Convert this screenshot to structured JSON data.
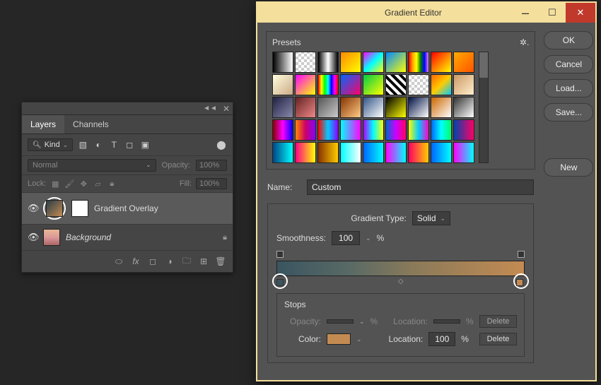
{
  "layers_panel": {
    "tabs": [
      "Layers",
      "Channels"
    ],
    "kind_label": "Kind",
    "blend_mode": "Normal",
    "opacity_label": "Opacity:",
    "opacity_value": "100%",
    "lock_label": "Lock:",
    "fill_label": "Fill:",
    "fill_value": "100%",
    "layers": [
      {
        "name": "Gradient Overlay",
        "italic": false
      },
      {
        "name": "Background",
        "italic": true
      }
    ]
  },
  "gradient_editor": {
    "title": "Gradient Editor",
    "presets_label": "Presets",
    "buttons": {
      "ok": "OK",
      "cancel": "Cancel",
      "load": "Load...",
      "save": "Save...",
      "new": "New"
    },
    "name_label": "Name:",
    "name_value": "Custom",
    "gradient_type_label": "Gradient Type:",
    "gradient_type_value": "Solid",
    "smoothness_label": "Smoothness:",
    "smoothness_value": "100",
    "stops": {
      "title": "Stops",
      "opacity_label": "Opacity:",
      "opacity_value": "",
      "opacity_loc_label": "Location:",
      "opacity_loc_value": "",
      "color_label": "Color:",
      "location_label": "Location:",
      "location_value": "100",
      "delete_label": "Delete",
      "percent": "%"
    },
    "gradient_stops": {
      "left_color": "#3a5560",
      "right_color": "#c38b52"
    }
  },
  "presets": [
    "linear-gradient(90deg,#000,#fff)",
    "repeating-conic-gradient(#ccc 0 25%,#fff 0 50%) 0/8px 8px",
    "linear-gradient(90deg,#000,#fff,#000)",
    "linear-gradient(135deg,#f80,#ff0)",
    "linear-gradient(135deg,#f0f,#0ff,#ff0)",
    "linear-gradient(135deg,#08f,#ff0)",
    "linear-gradient(90deg,red,orange,yellow,green,blue,violet)",
    "linear-gradient(135deg,#f00,#ff0)",
    "linear-gradient(135deg,#fa0,#f50)",
    "linear-gradient(135deg,#ffd,#ca8)",
    "linear-gradient(135deg,#f0f,#ff0)",
    "linear-gradient(90deg,red,yellow,lime,cyan,blue,magenta,red)",
    "linear-gradient(135deg,#06f,#f06)",
    "linear-gradient(135deg,#0c4,#ff0)",
    "repeating-linear-gradient(45deg,#000 0 4px,#fff 4px 8px)",
    "repeating-conic-gradient(#ccc 0 25%,#fff 0 50%) 0/8px 8px",
    "linear-gradient(135deg,#f60,#fc0,#0cf)",
    "linear-gradient(135deg,#c96,#fec)",
    "linear-gradient(135deg,#224,#88a)",
    "linear-gradient(135deg,#622,#e88)",
    "linear-gradient(135deg,#555,#ccc)",
    "linear-gradient(135deg,#830,#fc8)",
    "linear-gradient(135deg,#358,#fff)",
    "linear-gradient(135deg,#000,#ff0)",
    "linear-gradient(135deg,#014,#fff)",
    "linear-gradient(135deg,#c60,#fff)",
    "linear-gradient(135deg,#333,#fff)",
    "linear-gradient(90deg,#800,#f0f,#00f)",
    "linear-gradient(90deg,#f80,#c06,#80f)",
    "linear-gradient(90deg,#f00,#0cf,#80f)",
    "linear-gradient(90deg,#0ff,#f0f)",
    "linear-gradient(90deg,#a0f,#0ff,#ff0)",
    "linear-gradient(90deg,#06c,#c0f,#f06)",
    "linear-gradient(90deg,#ff0,#0cf,#f0c)",
    "linear-gradient(90deg,#06f,#0ff,#0f6)",
    "linear-gradient(90deg,#04a,#f06)",
    "linear-gradient(90deg,#048,#0ff)",
    "linear-gradient(90deg,#f08,#ff0)",
    "linear-gradient(90deg,#830,#fc0)",
    "linear-gradient(90deg,#0ff,#fff)",
    "linear-gradient(90deg,#06f,#0ff)",
    "linear-gradient(90deg,#f0f,#0ff)",
    "linear-gradient(90deg,#f06,#fc0)",
    "linear-gradient(90deg,#06f,#0ff)",
    "linear-gradient(90deg,#f0f,#0ff)"
  ]
}
